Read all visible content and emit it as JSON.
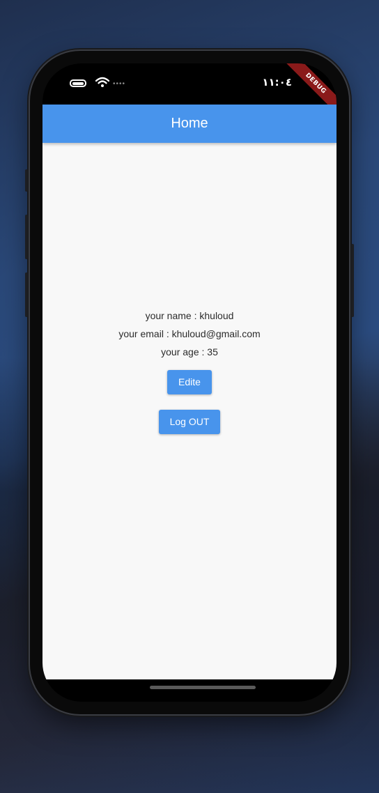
{
  "status_bar": {
    "time": "١١:٠٤",
    "debug_banner": "DEBUG",
    "icons": [
      "battery-icon",
      "wifi-icon",
      "signal-dots-icon"
    ]
  },
  "app_bar": {
    "title": "Home",
    "color": "#4894ec"
  },
  "profile": {
    "name_line": "your name : khuloud",
    "email_line": "your email : khuloud@gmail.com",
    "age_line": "your age : 35"
  },
  "actions": {
    "edit_label": "Edite",
    "logout_label": "Log OUT"
  },
  "colors": {
    "accent": "#4894ec",
    "background": "#f8f8f8",
    "debug": "#8a1a1a"
  }
}
